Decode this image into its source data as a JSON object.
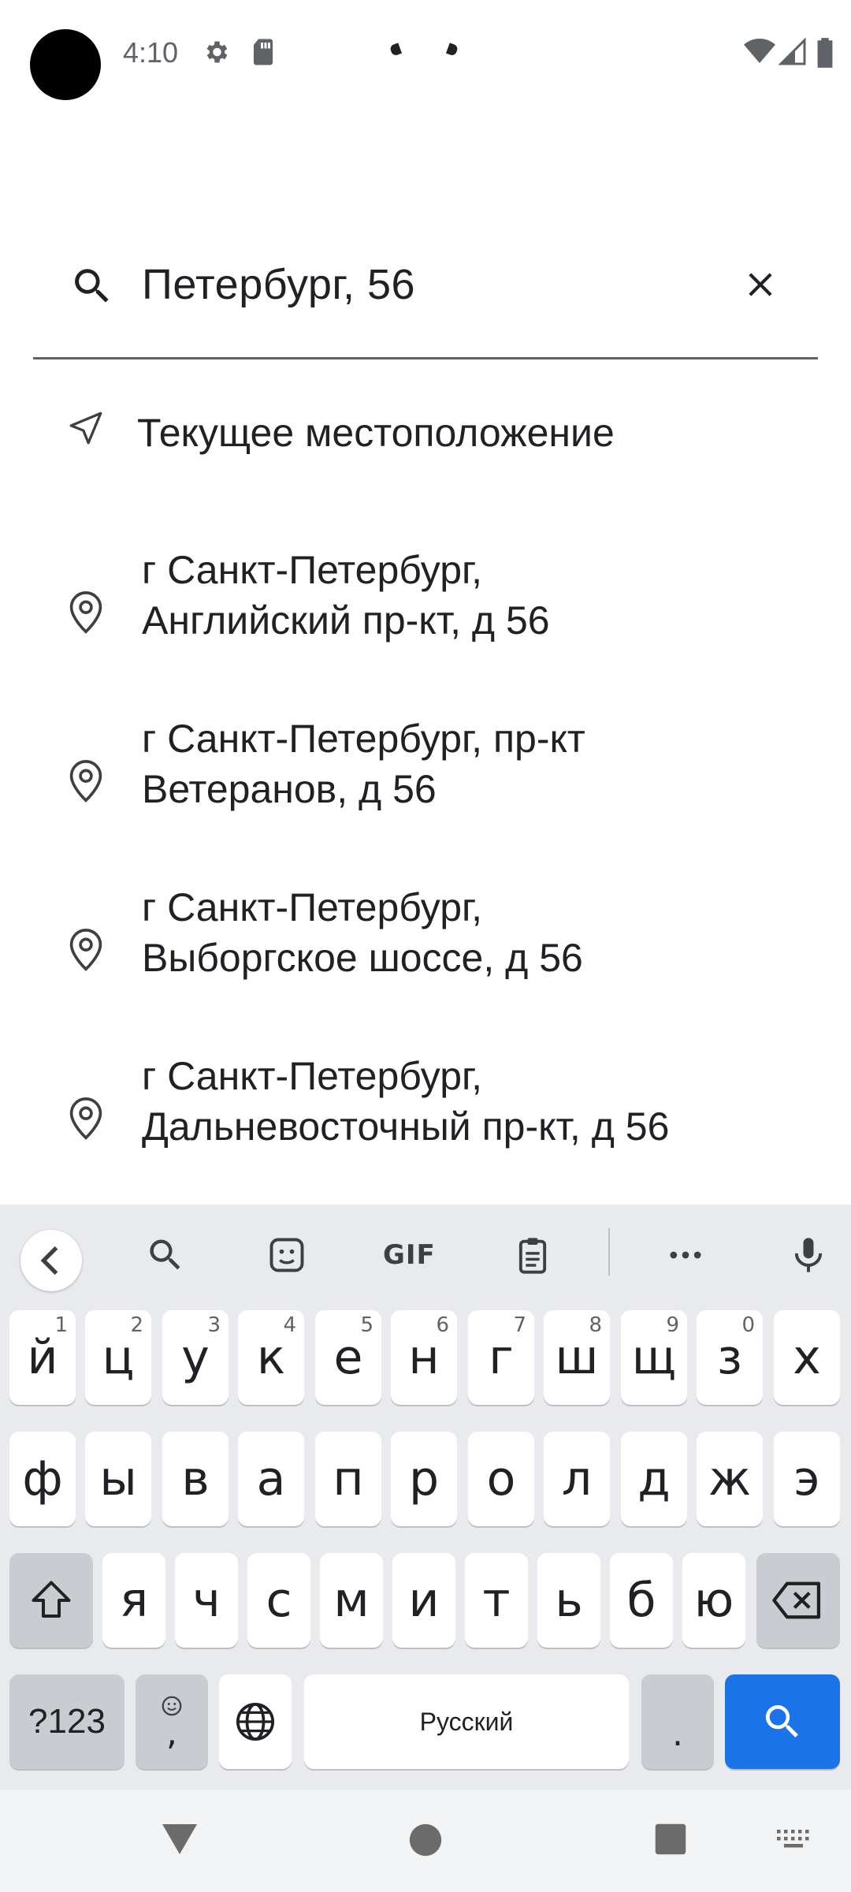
{
  "status_bar": {
    "time": "4:10",
    "icons": [
      "gear-icon",
      "sd-card-icon",
      "wifi-icon",
      "cell-signal-icon",
      "battery-icon"
    ]
  },
  "search": {
    "value": "Петербург, 56",
    "icon": "search-icon",
    "clear_icon": "close-icon"
  },
  "current_location": {
    "label": "Текущее местоположение",
    "icon": "navigation-arrow-icon"
  },
  "suggestions": [
    {
      "line1": "г Санкт-Петербург,",
      "line2": "Английский пр-кт, д 56"
    },
    {
      "line1": "г Санкт-Петербург, пр-кт",
      "line2": "Ветеранов, д 56"
    },
    {
      "line1": "г Санкт-Петербург,",
      "line2": "Выборгское шоссе, д 56"
    },
    {
      "line1": "г Санкт-Петербург,",
      "line2": "Дальневосточный пр-кт, д 56"
    }
  ],
  "keyboard": {
    "toolbar": {
      "gif": "GIF"
    },
    "row1": [
      {
        "k": "й",
        "n": "1"
      },
      {
        "k": "ц",
        "n": "2"
      },
      {
        "k": "у",
        "n": "3"
      },
      {
        "k": "к",
        "n": "4"
      },
      {
        "k": "е",
        "n": "5"
      },
      {
        "k": "н",
        "n": "6"
      },
      {
        "k": "г",
        "n": "7"
      },
      {
        "k": "ш",
        "n": "8"
      },
      {
        "k": "щ",
        "n": "9"
      },
      {
        "k": "з",
        "n": "0"
      },
      {
        "k": "х",
        "n": ""
      }
    ],
    "row2": [
      "ф",
      "ы",
      "в",
      "а",
      "п",
      "р",
      "о",
      "л",
      "д",
      "ж",
      "э"
    ],
    "row3": [
      "я",
      "ч",
      "с",
      "м",
      "и",
      "т",
      "ь",
      "б",
      "ю"
    ],
    "symbols_label": "?123",
    "emoji_comma": ",",
    "space_label": "Русский",
    "period": ".",
    "accent_color": "#1a73e8"
  }
}
